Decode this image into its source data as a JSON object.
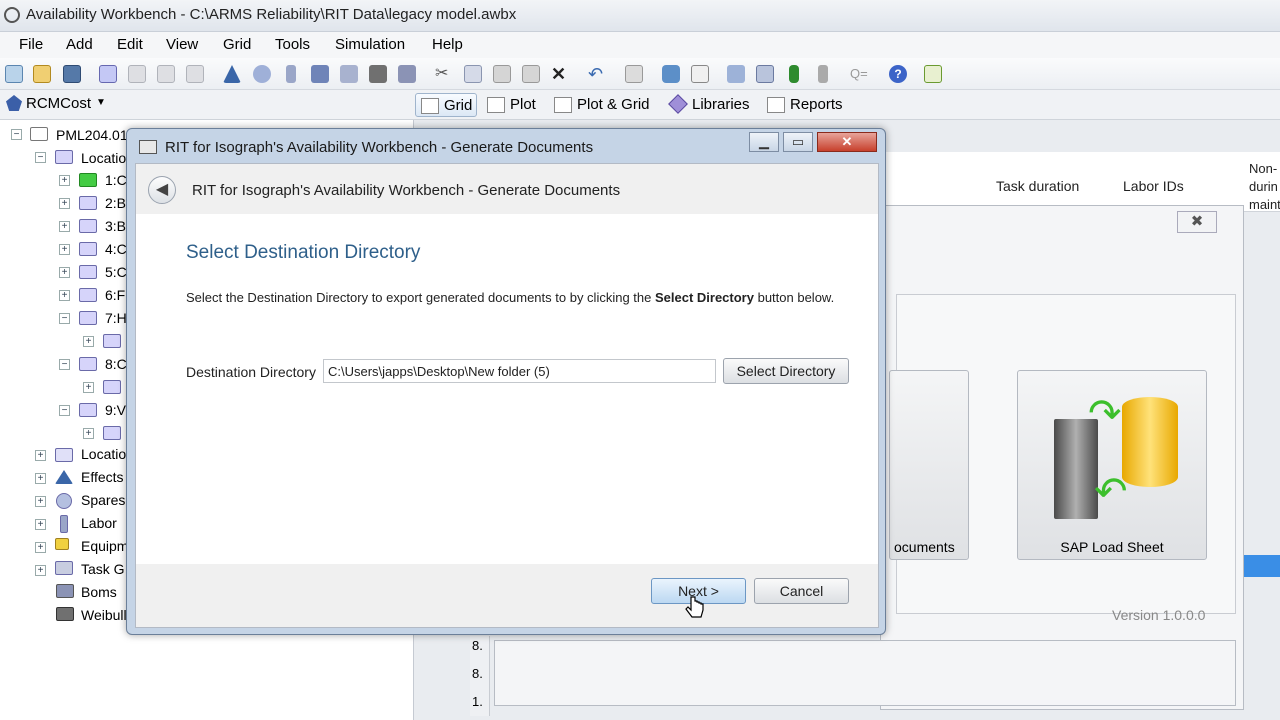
{
  "window": {
    "title": "Availability Workbench - C:\\ARMS Reliability\\RIT Data\\legacy model.awbx"
  },
  "menu": [
    "File",
    "Add",
    "Edit",
    "View",
    "Grid",
    "Tools",
    "Simulation",
    "Help"
  ],
  "toolbar2": {
    "profile": "RCMCost",
    "tabs": [
      "Grid",
      "Plot",
      "Plot & Grid",
      "Libraries",
      "Reports"
    ]
  },
  "tree": {
    "root": "PML204.01",
    "items": [
      {
        "label": "Locatio",
        "expander": "-",
        "level": 1
      },
      {
        "label": "1:C",
        "expander": "+",
        "level": 2,
        "icon_color": "#44cc44"
      },
      {
        "label": "2:B",
        "expander": "+",
        "level": 2
      },
      {
        "label": "3:B",
        "expander": "+",
        "level": 2
      },
      {
        "label": "4:C",
        "expander": "+",
        "level": 2
      },
      {
        "label": "5:C",
        "expander": "+",
        "level": 2
      },
      {
        "label": "6:F",
        "expander": "+",
        "level": 2
      },
      {
        "label": "7:H",
        "expander": "-",
        "level": 2
      },
      {
        "label": "",
        "expander": "+",
        "level": 3
      },
      {
        "label": "8:C",
        "expander": "-",
        "level": 2
      },
      {
        "label": "",
        "expander": "+",
        "level": 3
      },
      {
        "label": "9:V",
        "expander": "-",
        "level": 2
      },
      {
        "label": "",
        "expander": "+",
        "level": 3
      },
      {
        "label": "Locatio",
        "expander": "+",
        "level": 1
      },
      {
        "label": "Effects",
        "expander": "+",
        "level": 1
      },
      {
        "label": "Spares",
        "expander": "+",
        "level": 1
      },
      {
        "label": "Labor",
        "expander": "+",
        "level": 1
      },
      {
        "label": "Equipm",
        "expander": "+",
        "level": 1
      },
      {
        "label": "Task G",
        "expander": "+",
        "level": 1
      },
      {
        "label": "Boms",
        "expander": "",
        "level": 1
      },
      {
        "label": "Weibull",
        "expander": "",
        "level": 1
      }
    ]
  },
  "grid_columns": [
    "Task duration",
    "Labor IDs",
    "Non-\ndurin\nmaint"
  ],
  "row_numbers": [
    "8.",
    "8.",
    "1."
  ],
  "background_dialog": {
    "card1_label": "ocuments",
    "card2_label": "SAP Load Sheet",
    "version": "Version 1.0.0.0",
    "close": "✖"
  },
  "dialog": {
    "title": "RIT for Isograph's Availability Workbench - Generate Documents",
    "header": "RIT for Isograph's Availability Workbench - Generate Documents",
    "page_title": "Select Destination Directory",
    "desc_pre": "Select the Destination Directory to export generated documents to by clicking the ",
    "desc_bold": "Select Directory",
    "desc_post": " button below.",
    "dest_label": "Destination Directory",
    "dest_value": "C:\\Users\\japps\\Desktop\\New folder (5)",
    "select_dir": "Select Directory",
    "next": "Next >",
    "cancel": "Cancel"
  },
  "colors": {
    "accent_title": "#2e5f8a",
    "close_red": "#c7402c"
  }
}
